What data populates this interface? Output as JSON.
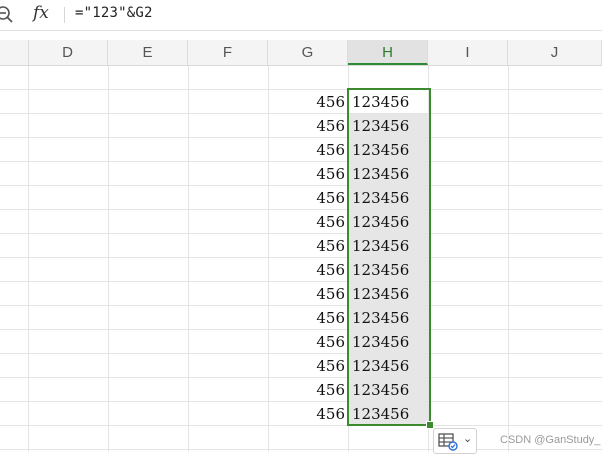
{
  "formula_bar": {
    "fx_label": "fx",
    "formula": "=\"123\"&G2"
  },
  "columns": [
    {
      "label": "D",
      "selected": false
    },
    {
      "label": "E",
      "selected": false
    },
    {
      "label": "F",
      "selected": false
    },
    {
      "label": "G",
      "selected": false
    },
    {
      "label": "H",
      "selected": true
    },
    {
      "label": "I",
      "selected": false
    },
    {
      "label": "J",
      "selected": false
    }
  ],
  "rows": [
    {
      "g": "",
      "h": ""
    },
    {
      "g": "456",
      "h": "123456"
    },
    {
      "g": "456",
      "h": "123456"
    },
    {
      "g": "456",
      "h": "123456"
    },
    {
      "g": "456",
      "h": "123456"
    },
    {
      "g": "456",
      "h": "123456"
    },
    {
      "g": "456",
      "h": "123456"
    },
    {
      "g": "456",
      "h": "123456"
    },
    {
      "g": "456",
      "h": "123456"
    },
    {
      "g": "456",
      "h": "123456"
    },
    {
      "g": "456",
      "h": "123456"
    },
    {
      "g": "456",
      "h": "123456"
    },
    {
      "g": "456",
      "h": "123456"
    },
    {
      "g": "456",
      "h": "123456"
    },
    {
      "g": "456",
      "h": "123456"
    },
    {
      "g": "",
      "h": ""
    }
  ],
  "paste_options": {
    "icon": "paste-options-icon",
    "chevron": "⌄"
  },
  "watermark": "CSDN @GanStudy_",
  "colors": {
    "selection": "#3c8a2e",
    "selected_fill": "#e6e6e6",
    "header_bg": "#f4f4f4"
  }
}
